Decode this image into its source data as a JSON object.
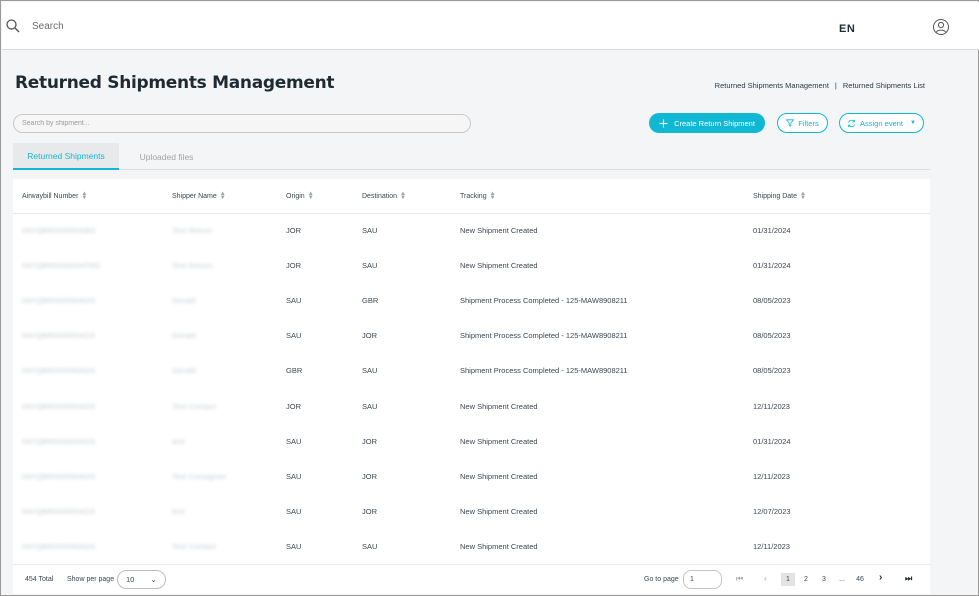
{
  "topbar": {
    "search_placeholder": "Search",
    "language": "EN"
  },
  "page": {
    "title": "Returned Shipments Management",
    "breadcrumb": [
      "Returned Shipments Management",
      "Returned Shipments List"
    ],
    "breadcrumb_separator": "|"
  },
  "toolbar": {
    "search_placeholder": "Search by shipment...",
    "create_label": "Create Return Shipment",
    "filters_label": "Filters",
    "assign_label": "Assign event"
  },
  "tabs": [
    {
      "label": "Returned Shipments",
      "active": true
    },
    {
      "label": "Uploaded files",
      "active": false
    }
  ],
  "table": {
    "columns": [
      "Airwaybill Number",
      "Shipper Name",
      "Origin",
      "Destination",
      "Tracking",
      "Shipping Date"
    ],
    "rows": [
      {
        "awb": "0AYQBR000000ABG",
        "shipper": "Test Return",
        "origin": "JOR",
        "destination": "SAU",
        "tracking": "New Shipment Created",
        "date": "01/31/2024"
      },
      {
        "awb": "0AYQBR000000ATRG",
        "shipper": "Test Return",
        "origin": "JOR",
        "destination": "SAU",
        "tracking": "New Shipment Created",
        "date": "01/31/2024"
      },
      {
        "awb": "0AYQBR000000ADS",
        "shipper": "Gerald",
        "origin": "SAU",
        "destination": "GBR",
        "tracking": "Shipment Process Completed - 125-MAW8908211",
        "date": "08/05/2023"
      },
      {
        "awb": "0AYQBR000000ADS",
        "shipper": "Gerald",
        "origin": "SAU",
        "destination": "JOR",
        "tracking": "Shipment Process Completed - 125-MAW8908211",
        "date": "08/05/2023"
      },
      {
        "awb": "0AYQBR000000ADS",
        "shipper": "Gerald",
        "origin": "GBR",
        "destination": "SAU",
        "tracking": "Shipment Process Completed - 125-MAW8908211",
        "date": "08/05/2023"
      },
      {
        "awb": "0AYQBR000000ADS",
        "shipper": "Test Contact",
        "origin": "JOR",
        "destination": "SAU",
        "tracking": "New Shipment Created",
        "date": "12/11/2023"
      },
      {
        "awb": "0AYQBR000000ADS",
        "shipper": "test",
        "origin": "SAU",
        "destination": "JOR",
        "tracking": "New Shipment Created",
        "date": "01/31/2024"
      },
      {
        "awb": "0AYQBR000000ADS",
        "shipper": "Test Consignee",
        "origin": "SAU",
        "destination": "JOR",
        "tracking": "New Shipment Created",
        "date": "12/11/2023"
      },
      {
        "awb": "0AYQBR000000ADS",
        "shipper": "test",
        "origin": "SAU",
        "destination": "JOR",
        "tracking": "New Shipment Created",
        "date": "12/07/2023"
      },
      {
        "awb": "0AYQBR000000ADS",
        "shipper": "Test Contact",
        "origin": "SAU",
        "destination": "SAU",
        "tracking": "New Shipment Created",
        "date": "12/11/2023"
      }
    ]
  },
  "footer": {
    "total": "454 Total",
    "per_page_label": "Show per page",
    "per_page_value": "10",
    "goto_label": "Go to page",
    "goto_value": "1",
    "pages": [
      "1",
      "2",
      "3",
      "...",
      "46"
    ],
    "current_page": "1"
  },
  "colors": {
    "accent": "#11b8d4",
    "title": "#1f2b33"
  }
}
